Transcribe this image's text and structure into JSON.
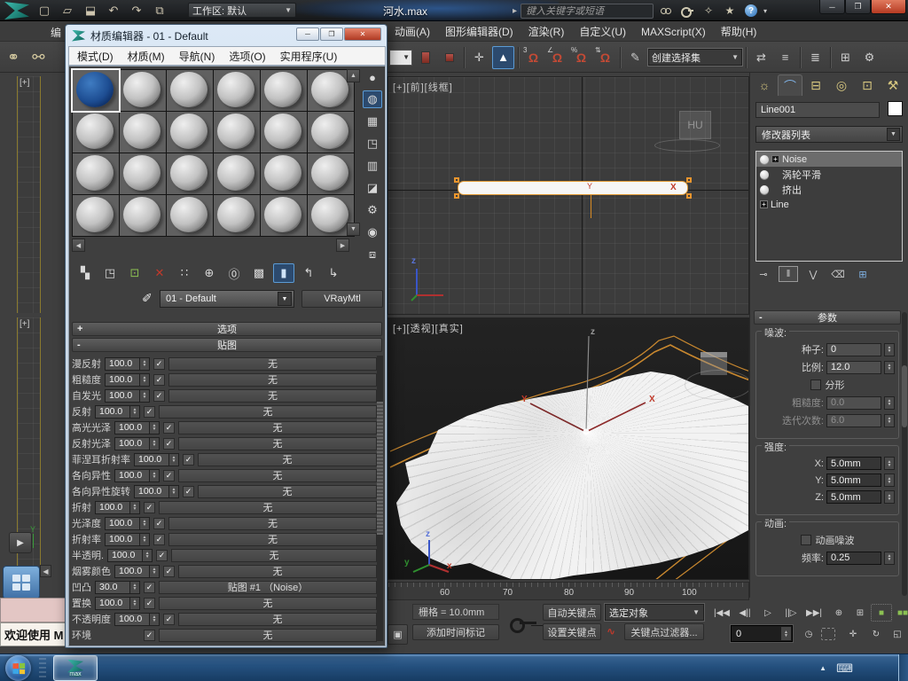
{
  "titlebar": {
    "workspace": "工作区: 默认",
    "filename": "河水.max",
    "search_placeholder": "键入关键字或短语"
  },
  "menubar": {
    "partial": "编",
    "items": [
      "动画(A)",
      "图形编辑器(D)",
      "渲染(R)",
      "自定义(U)",
      "MAXScript(X)",
      "帮助(H)"
    ]
  },
  "toolbar": {
    "selection_set": "创建选择集"
  },
  "material_editor": {
    "title": "材质编辑器 - 01 - Default",
    "menu": [
      "模式(D)",
      "材质(M)",
      "导航(N)",
      "选项(O)",
      "实用程序(U)"
    ],
    "slots": [
      {
        "sel": true
      },
      {},
      {},
      {},
      {},
      {},
      {},
      {},
      {},
      {},
      {},
      {},
      {},
      {},
      {},
      {},
      {},
      {},
      {},
      {},
      {},
      {},
      {},
      {}
    ],
    "material_name": "01 - Default",
    "material_type": "VRayMtl",
    "rollouts": {
      "options": "选项",
      "maps": "贴图"
    },
    "maps": [
      {
        "label": "漫反射",
        "amount": "100.0",
        "map": "无"
      },
      {
        "label": "粗糙度",
        "amount": "100.0",
        "map": "无"
      },
      {
        "label": "自发光",
        "amount": "100.0",
        "map": "无"
      },
      {
        "label": "反射",
        "amount": "100.0",
        "map": "无"
      },
      {
        "label": "高光光泽",
        "amount": "100.0",
        "map": "无"
      },
      {
        "label": "反射光泽",
        "amount": "100.0",
        "map": "无"
      },
      {
        "label": "菲涅耳折射率",
        "amount": "100.0",
        "map": "无"
      },
      {
        "label": "各向异性",
        "amount": "100.0",
        "map": "无"
      },
      {
        "label": "各向异性旋转",
        "amount": "100.0",
        "map": "无"
      },
      {
        "label": "折射",
        "amount": "100.0",
        "map": "无"
      },
      {
        "label": "光泽度",
        "amount": "100.0",
        "map": "无"
      },
      {
        "label": "折射率",
        "amount": "100.0",
        "map": "无"
      },
      {
        "label": "半透明.",
        "amount": "100.0",
        "map": "无"
      },
      {
        "label": "烟雾颜色",
        "amount": "100.0",
        "map": "无"
      },
      {
        "label": "凹凸",
        "amount": "30.0",
        "map": "贴图 #1 （Noise）"
      },
      {
        "label": "置换",
        "amount": "100.0",
        "map": "无"
      },
      {
        "label": "不透明度",
        "amount": "100.0",
        "map": "无"
      },
      {
        "label": "环境",
        "amount": "",
        "map": "无",
        "noamount": true
      }
    ]
  },
  "viewports": {
    "front_label": "[+][前][线框]",
    "persp_label": "[+][透视][真实]",
    "viewcube_text": "HU",
    "gizmo": {
      "x": "X",
      "y": "Y",
      "z": "z"
    },
    "axis": {
      "x": "x",
      "y": "y",
      "z": "z"
    }
  },
  "timeline": {
    "ticks": [
      "60",
      "70",
      "80",
      "90",
      "100"
    ]
  },
  "statusbar": {
    "grid": "栅格 = 10.0mm",
    "add_time_tag": "添加时间标记",
    "auto_key": "自动关键点",
    "set_key": "设置关键点",
    "selection_filter": "选定对象",
    "key_filters": "关键点过滤器...",
    "frame": "0"
  },
  "command_panel": {
    "object_name": "Line001",
    "modifier_list": "修改器列表",
    "stack": [
      {
        "name": "Noise",
        "sel": true,
        "plus": true
      },
      {
        "name": "涡轮平滑"
      },
      {
        "name": "挤出"
      },
      {
        "name": "Line",
        "plus": true,
        "nobulb": true
      }
    ],
    "params_title": "参数",
    "noise": {
      "title": "噪波:",
      "seed_label": "种子:",
      "seed": "0",
      "scale_label": "比例:",
      "scale": "12.0",
      "fractal_label": "分形",
      "rough_label": "粗糙度:",
      "rough": "0.0",
      "iter_label": "迭代次数:",
      "iter": "6.0"
    },
    "strength": {
      "title": "强度:",
      "x_label": "X:",
      "x": "5.0mm",
      "y_label": "Y:",
      "y": "5.0mm",
      "z_label": "Z:",
      "z": "5.0mm"
    },
    "animation": {
      "title": "动画:",
      "animate_label": "动画噪波",
      "freq_label": "频率:",
      "freq": "0.25"
    }
  },
  "mini_listener": {
    "text": "欢迎使用 M"
  },
  "taskbar": {
    "max_label": "max"
  }
}
